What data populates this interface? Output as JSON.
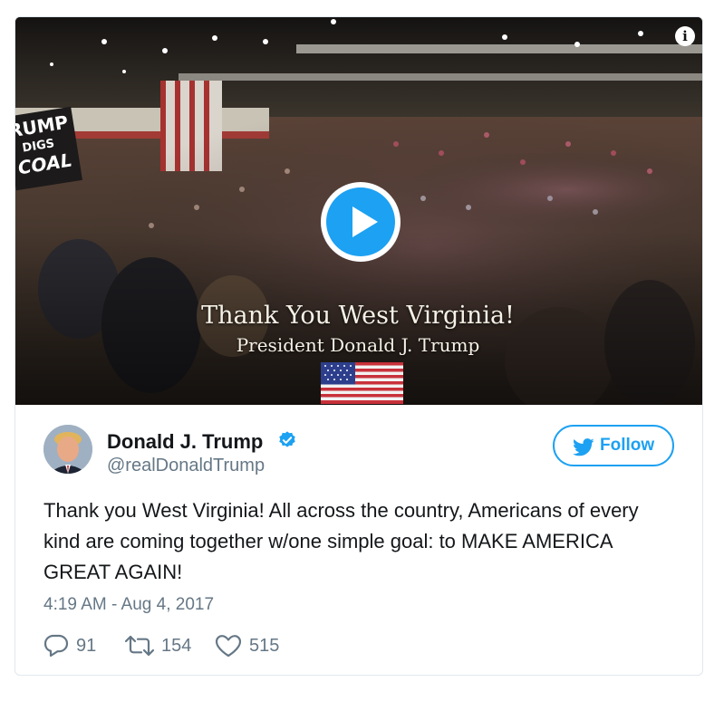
{
  "media": {
    "caption_line1": "Thank You West Virginia!",
    "caption_line2": "President Donald J. Trump",
    "sign_line1": "RUMP",
    "sign_line2": "DIGS",
    "sign_line3": "COAL",
    "info_icon_glyph": "i",
    "play_icon": "play-icon",
    "play_color": "#1da1f2"
  },
  "author": {
    "name": "Donald J. Trump",
    "handle": "@realDonaldTrump",
    "verified": true,
    "verified_color": "#1da1f2"
  },
  "follow_button": {
    "label": "Follow",
    "color": "#1da1f2"
  },
  "tweet": {
    "text": "Thank you West Virginia! All across the country, Americans of every kind are coming together w/one simple goal: to MAKE AMERICA GREAT AGAIN!",
    "timestamp": "4:19 AM - Aug 4, 2017"
  },
  "actions": {
    "replies": "91",
    "retweets": "154",
    "likes": "515"
  }
}
